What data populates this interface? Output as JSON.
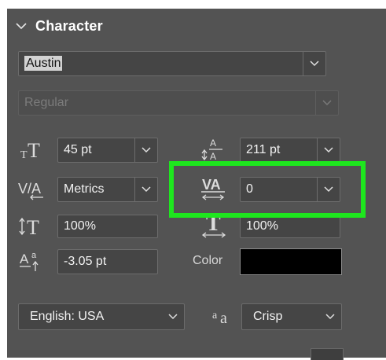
{
  "panel": {
    "title": "Character",
    "colors": {
      "background": "#535353",
      "field": "#454545",
      "highlight": "#1ee61e",
      "swatch": "#000000"
    }
  },
  "font_family": {
    "value": "Austin"
  },
  "font_style": {
    "value": "Regular",
    "disabled": true
  },
  "font_size": {
    "value": "45 pt",
    "icon": "font-size-icon"
  },
  "leading": {
    "value": "211 pt",
    "icon": "leading-icon"
  },
  "kerning": {
    "value": "Metrics",
    "icon": "kerning-icon"
  },
  "tracking": {
    "value": "0",
    "icon": "tracking-icon",
    "highlighted": true
  },
  "vertical_scale": {
    "value": "100%",
    "icon": "vertical-scale-icon"
  },
  "horizontal_scale": {
    "value": "100%",
    "icon": "horizontal-scale-icon"
  },
  "baseline_shift": {
    "value": "-3.05 pt",
    "icon": "baseline-shift-icon"
  },
  "color": {
    "label": "Color",
    "value": "#000000"
  },
  "language": {
    "value": "English: USA"
  },
  "antialias": {
    "value": "Crisp",
    "icon_text": "a",
    "icon_sub": "a"
  }
}
